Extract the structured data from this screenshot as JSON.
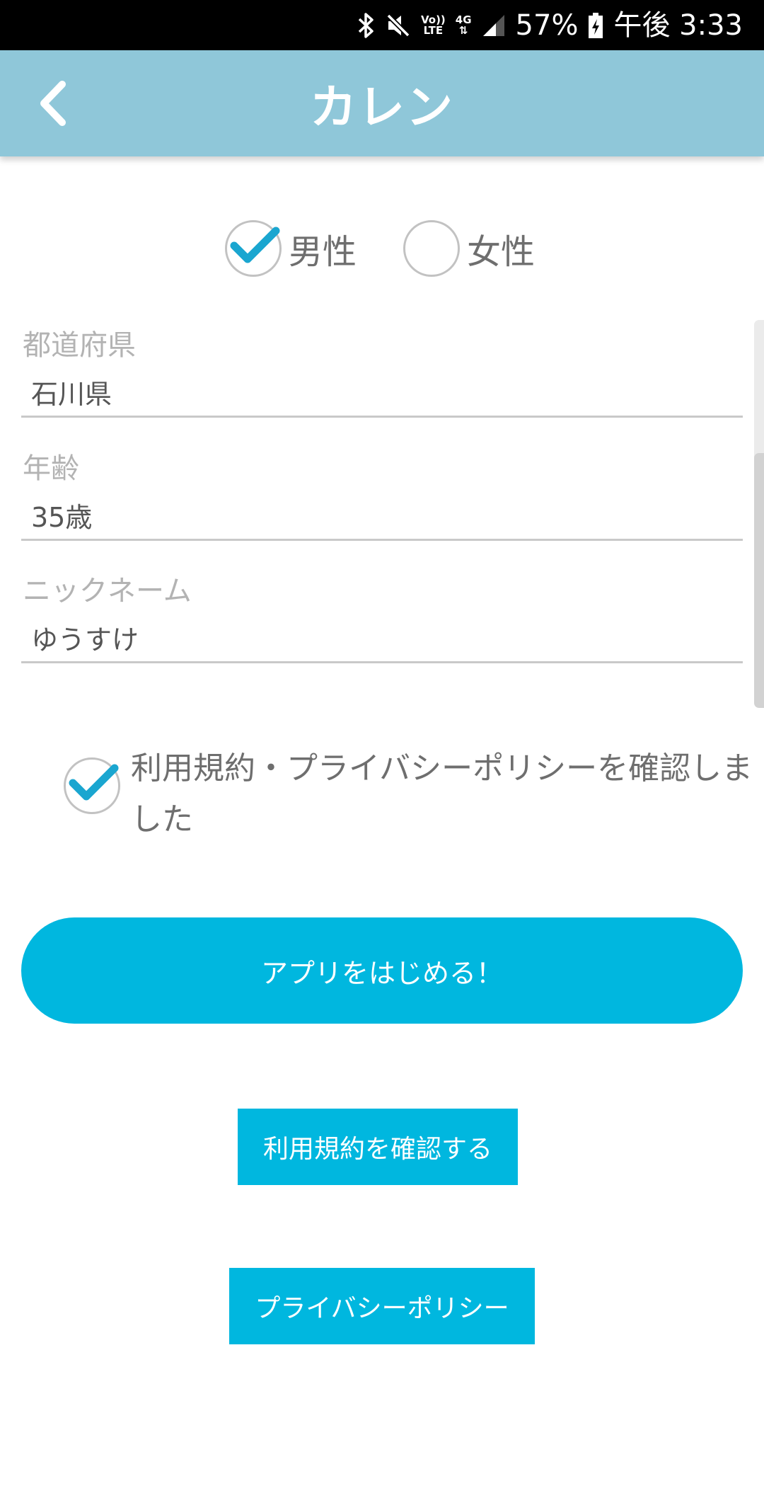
{
  "status_bar": {
    "volte_label": "Vo))",
    "lte_label": "LTE",
    "network_label": "4G",
    "battery_percent": "57%",
    "time": "午後 3:33"
  },
  "header": {
    "title": "カレン",
    "back_icon": "chevron-left-icon"
  },
  "gender": {
    "options": [
      {
        "label": "男性",
        "selected": true
      },
      {
        "label": "女性",
        "selected": false
      }
    ]
  },
  "form": {
    "prefecture": {
      "label": "都道府県",
      "value": "石川県"
    },
    "age": {
      "label": "年齢",
      "value": "35歳"
    },
    "nickname": {
      "label": "ニックネーム",
      "value": "ゆうすけ"
    }
  },
  "agreement": {
    "text": "利用規約・プライバシーポリシーを確認しました",
    "checked": true
  },
  "buttons": {
    "start": "アプリをはじめる！",
    "terms": "利用規約を確認する",
    "privacy": "プライバシーポリシー"
  },
  "colors": {
    "header_bg": "#8fc7d9",
    "accent": "#00b7df",
    "check": "#1aa6d0"
  }
}
